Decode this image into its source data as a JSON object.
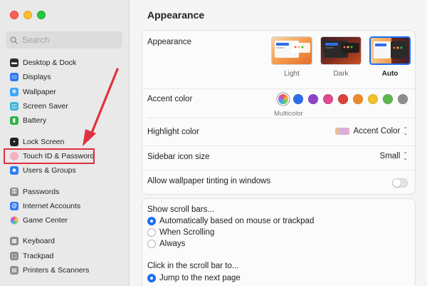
{
  "sidebar": {
    "search_placeholder": "Search",
    "groups": [
      [
        {
          "label": "Desktop & Dock",
          "icon": "dock-icon",
          "color": "#2a2a2a"
        },
        {
          "label": "Displays",
          "icon": "display-icon",
          "color": "#2f7bf0"
        },
        {
          "label": "Wallpaper",
          "icon": "wallpaper-icon",
          "color": "#3ea6f5"
        },
        {
          "label": "Screen Saver",
          "icon": "screen-saver-icon",
          "color": "#3bb6d6"
        },
        {
          "label": "Battery",
          "icon": "battery-icon",
          "color": "#33b04a"
        }
      ],
      [
        {
          "label": "Lock Screen",
          "icon": "lock-icon",
          "color": "#222222"
        },
        {
          "label": "Touch ID & Password",
          "icon": "fingerprint-icon",
          "color": "#f2b3bd",
          "highlighted": true
        },
        {
          "label": "Users & Groups",
          "icon": "users-icon",
          "color": "#2f7bf0"
        }
      ],
      [
        {
          "label": "Passwords",
          "icon": "key-icon",
          "color": "#8c8c8c"
        },
        {
          "label": "Internet Accounts",
          "icon": "at-icon",
          "color": "#2f7bf0"
        },
        {
          "label": "Game Center",
          "icon": "game-center-icon",
          "color": "#ffffff"
        }
      ],
      [
        {
          "label": "Keyboard",
          "icon": "keyboard-icon",
          "color": "#8c8c8c"
        },
        {
          "label": "Trackpad",
          "icon": "trackpad-icon",
          "color": "#8c8c8c"
        },
        {
          "label": "Printers & Scanners",
          "icon": "printer-icon",
          "color": "#8c8c8c"
        }
      ]
    ]
  },
  "main": {
    "title": "Appearance",
    "appearance": {
      "label": "Appearance",
      "options": [
        {
          "label": "Light",
          "selected": false
        },
        {
          "label": "Dark",
          "selected": false
        },
        {
          "label": "Auto",
          "selected": true
        }
      ]
    },
    "accent": {
      "label": "Accent color",
      "selected_name": "Multicolor",
      "colors": [
        "multicolor",
        "#2f6ee8",
        "#8e44c9",
        "#e0488f",
        "#d9443a",
        "#ec8a2b",
        "#f2c12e",
        "#5fb54a",
        "#8e8e8e"
      ]
    },
    "highlight": {
      "label": "Highlight color",
      "value": "Accent Color"
    },
    "sidebar_icon_size": {
      "label": "Sidebar icon size",
      "value": "Small"
    },
    "tinting": {
      "label": "Allow wallpaper tinting in windows",
      "on": false
    },
    "scroll_bars": {
      "label": "Show scroll bars...",
      "options": [
        {
          "label": "Automatically based on mouse or trackpad",
          "selected": true
        },
        {
          "label": "When Scrolling",
          "selected": false
        },
        {
          "label": "Always",
          "selected": false
        }
      ]
    },
    "click_scroll": {
      "label": "Click in the scroll bar to...",
      "options": [
        {
          "label": "Jump to the next page",
          "selected": true
        }
      ]
    }
  },
  "annotation_color": "#e03040"
}
